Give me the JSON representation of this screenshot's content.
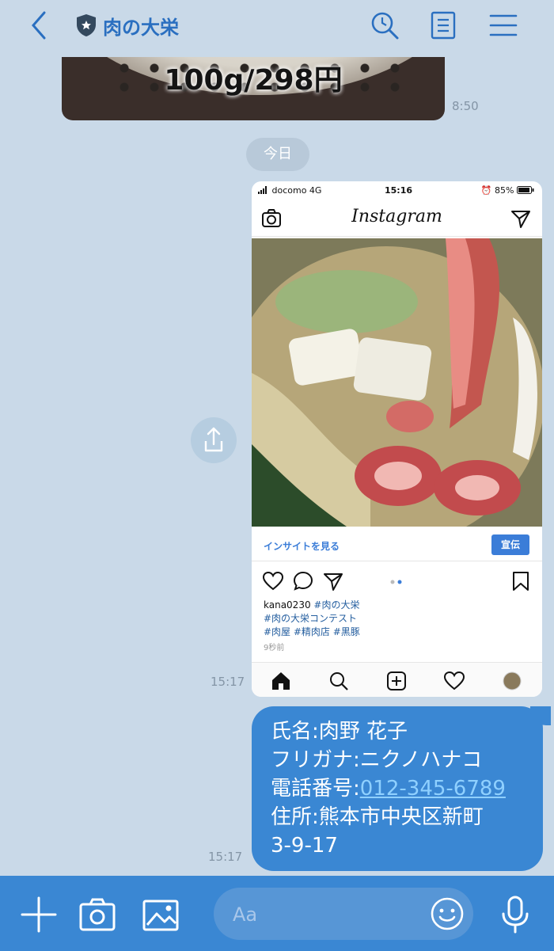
{
  "header": {
    "title": "肉の大栄",
    "icons": [
      "back-chevron-icon",
      "shield-star-icon",
      "search-icon",
      "notes-icon",
      "menu-icon"
    ]
  },
  "messages": {
    "prev_image": {
      "price_text": "100g/298円",
      "time": "8:50"
    },
    "date_separator": "今日",
    "instagram_shot": {
      "status": {
        "carrier": "docomo  4G",
        "clock": "15:16",
        "battery": "85%"
      },
      "app_name": "Instagram",
      "insight_link": "インサイトを見る",
      "promote_button": "宣伝",
      "caption": {
        "user": "kana0230",
        "line1_tag": " #肉の大栄",
        "line2": "#肉の大栄コンテスト",
        "line3": "#肉屋 #精肉店 #黒豚",
        "ago": "9秒前"
      },
      "time": "15:17"
    },
    "text_bubble": {
      "name": "氏名:肉野 花子",
      "kana": "フリガナ:ニクノハナコ",
      "phone_label": "電話番号:",
      "phone": "012-345-6789",
      "address1": "住所:熊本市中央区新町",
      "address2": "3-9-17",
      "time": "15:17"
    }
  },
  "input_bar": {
    "placeholder": "Aa",
    "icons": [
      "plus-icon",
      "camera-icon",
      "image-icon",
      "emoji-icon",
      "microphone-icon"
    ]
  },
  "colors": {
    "background": "#c9d9e8",
    "accent": "#3a87d3",
    "header_text": "#2a6fc0"
  }
}
